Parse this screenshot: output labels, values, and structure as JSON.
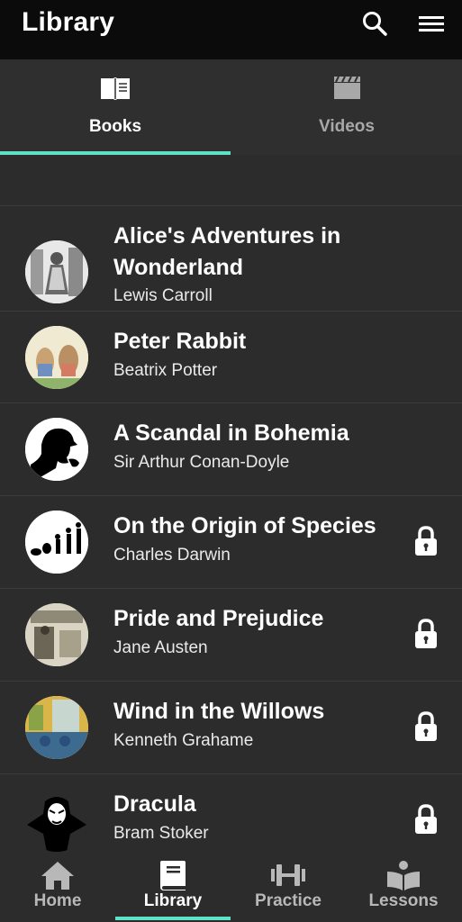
{
  "header": {
    "title": "Library",
    "search_icon": "search-icon",
    "menu_icon": "hamburger-menu-icon"
  },
  "tabs": [
    {
      "label": "Books",
      "icon": "open-book-icon",
      "active": true
    },
    {
      "label": "Videos",
      "icon": "clapperboard-icon",
      "active": false
    }
  ],
  "books": [
    {
      "title": "Alice's Adventures in Wonderland",
      "title_line1": "Alice's Adventures in",
      "title_line2": "Wonderland",
      "author": "Lewis Carroll",
      "locked": false
    },
    {
      "title": "Peter Rabbit",
      "author": "Beatrix Potter",
      "locked": false
    },
    {
      "title": "A Scandal in Bohemia",
      "author": "Sir Arthur Conan-Doyle",
      "locked": false
    },
    {
      "title": "On the Origin of Species",
      "author": "Charles Darwin",
      "locked": true
    },
    {
      "title": "Pride and Prejudice",
      "author": "Jane Austen",
      "locked": true
    },
    {
      "title": "Wind in the Willows",
      "author": "Kenneth Grahame",
      "locked": true
    },
    {
      "title": "Dracula",
      "author": "Bram Stoker",
      "locked": true
    }
  ],
  "bottom_nav": [
    {
      "label": "Home",
      "icon": "home-icon",
      "active": false
    },
    {
      "label": "Library",
      "icon": "book-icon",
      "active": true
    },
    {
      "label": "Practice",
      "icon": "dumbbell-icon",
      "active": false
    },
    {
      "label": "Lessons",
      "icon": "reader-icon",
      "active": false
    }
  ],
  "colors": {
    "accent": "#5fe0c8",
    "background": "#2c2c2c",
    "topbar": "#0b0b0b"
  }
}
